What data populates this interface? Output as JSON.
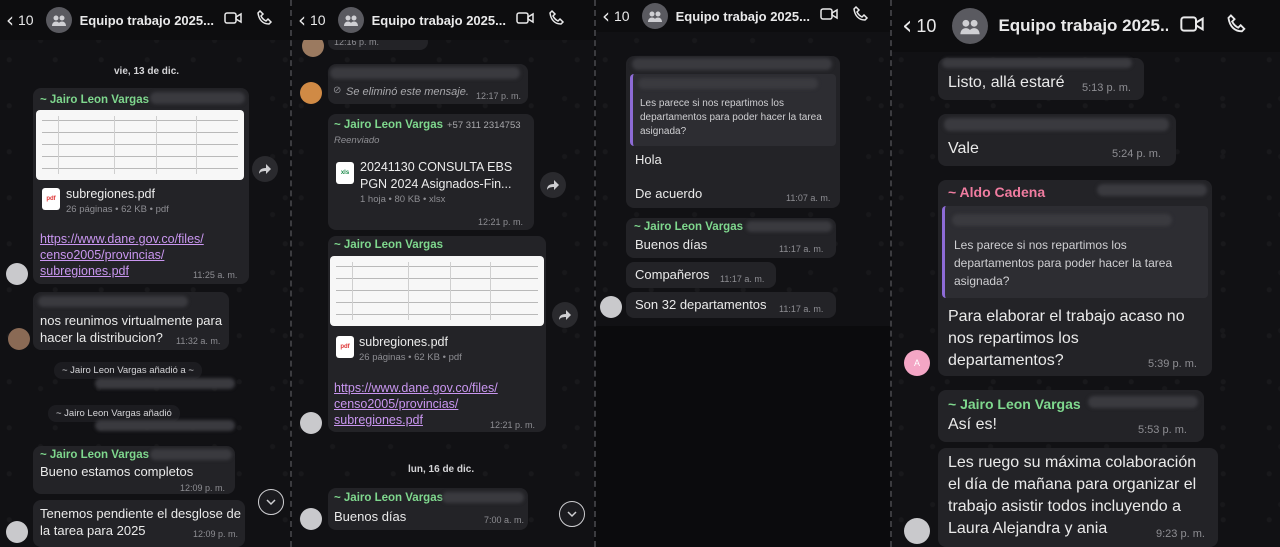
{
  "header": {
    "back_count": "10",
    "title": "Equipo trabajo 2025..."
  },
  "panel1": {
    "date": "vie, 13 de dic.",
    "m1_sender": "~ Jairo Leon Vargas",
    "m1_file": "subregiones.pdf",
    "m1_meta": "26 páginas • 62 KB • pdf",
    "m1_link": "https://www.dane.gov.co/files/censo2005/provincias/subregiones.pdf",
    "m1_link_l1": "https://www.dane.gov.co/files/",
    "m1_link_l2": "censo2005/provincias/",
    "m1_link_l3": "subregiones.pdf",
    "m1_time": "11:25 a. m.",
    "m2_text_l1": "nos reunimos virtualmente para",
    "m2_text_l2": "hacer la distribucion?",
    "m2_time": "11:32 a. m.",
    "sys1": "~ Jairo Leon Vargas añadió a ~",
    "sys2": "~ Jairo Leon Vargas añadió",
    "m3_sender": "~ Jairo Leon Vargas",
    "m3_text": "Bueno estamos completos",
    "m3_time": "12:09 p. m.",
    "m4_text_l1": "Tenemos pendiente el desglose de",
    "m4_text_l2": "la tarea para 2025",
    "m4_time": "12:09 p. m."
  },
  "panel2": {
    "t0": "12:16 p. m.",
    "deleted": "Se eliminó este mensaje.",
    "deleted_time": "12:17 p. m.",
    "m1_sender": "~ Jairo Leon Vargas",
    "m1_phone": "+57 311 2314753",
    "m1_fwd": "Reenviado",
    "m1_file_l1": "20241130 CONSULTA EBS",
    "m1_file_l2": "PGN 2024 Asignados-Fin...",
    "m1_meta": "1 hoja • 80 KB • xlsx",
    "m1_time": "12:21 p. m.",
    "m2_sender": "~ Jairo Leon Vargas",
    "m2_file": "subregiones.pdf",
    "m2_meta": "26 páginas • 62 KB • pdf",
    "m2_link_l1": "https://www.dane.gov.co/files/",
    "m2_link_l2": "censo2005/provincias/",
    "m2_link_l3": "subregiones.pdf",
    "m2_time": "12:21 p. m.",
    "date": "lun, 16 de dic.",
    "m3_sender": "~ Jairo Leon Vargas",
    "m3_text": "Buenos días",
    "m3_time": "7:00 a. m."
  },
  "panel3": {
    "q1_text_l1": "Les parece si nos repartimos los",
    "q1_text_l2": "departamentos para poder hacer la tarea",
    "q1_text_l3": "asignada?",
    "r1_l1": "Hola",
    "r1_l2": "De acuerdo",
    "r1_time": "11:07 a. m.",
    "m2_sender": "~ Jairo Leon Vargas",
    "m2_text": "Buenos días",
    "m2_time": "11:17 a. m.",
    "m3_text": "Compañeros",
    "m3_time": "11:17 a. m.",
    "m4_text": "Son 32 departamentos",
    "m4_time": "11:17 a. m."
  },
  "panel4": {
    "m1_text": "Listo, allá estaré",
    "m1_time": "5:13 p. m.",
    "m2_text": "Vale",
    "m2_time": "5:24 p. m.",
    "m3_sender": "~ Aldo Cadena",
    "m3_avatar": "A",
    "q_l1": "Les parece si nos repartimos los",
    "q_l2": "departamentos para poder hacer la tarea",
    "q_l3": "asignada?",
    "m3_l1": "Para elaborar el trabajo acaso  no",
    "m3_l2": "nos repartimos los",
    "m3_l3": "departamentos?",
    "m3_time": "5:39 p. m.",
    "m4_sender": "~ Jairo Leon Vargas",
    "m4_text": "Así es!",
    "m4_time": "5:53 p. m.",
    "m5_l1": "Les ruego su máxima colaboración",
    "m5_l2": "el día de mañana para organizar el",
    "m5_l3": "trabajo asistir todos incluyendo a",
    "m5_l4": "Laura Alejandra y ania",
    "m5_time": "9:23 p. m."
  },
  "colors": {
    "sender_green": "#7fd88e",
    "sender_pink": "#f07ca0",
    "link": "#c996f0",
    "bubble": "#232327",
    "quote_bar": "#8d6bd6"
  },
  "icons": [
    "chevron-left-icon",
    "group-avatar-icon",
    "video-call-icon",
    "phone-icon",
    "forward-icon",
    "pdf-file-icon",
    "xlsx-file-icon",
    "deleted-icon",
    "scroll-down-icon"
  ]
}
